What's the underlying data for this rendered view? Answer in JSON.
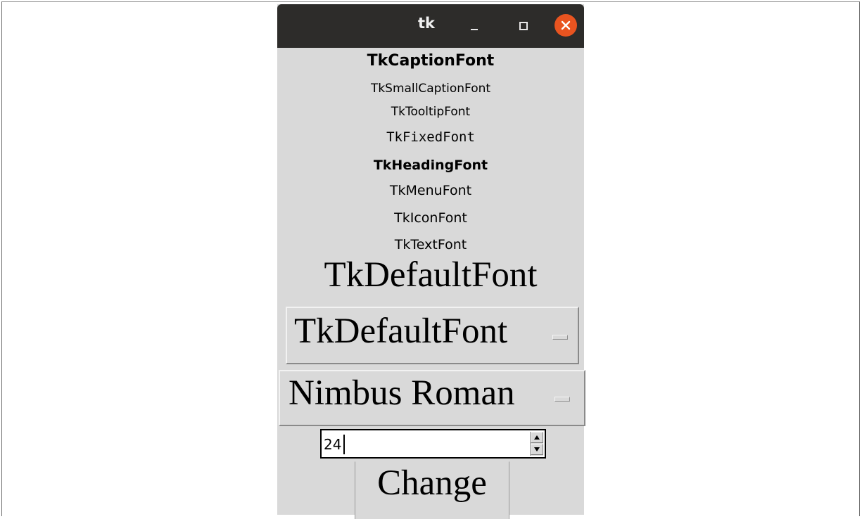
{
  "window": {
    "title": "tk",
    "controls": {
      "minimize_icon": "minimize-icon",
      "maximize_icon": "maximize-icon",
      "close_icon": "close-icon",
      "close_color": "#e95420"
    }
  },
  "fonts": {
    "caption": "TkCaptionFont",
    "small_caption": "TkSmallCaptionFont",
    "tooltip": "TkTooltipFont",
    "fixed": "TkFixedFont",
    "heading": "TkHeadingFont",
    "menu": "TkMenuFont",
    "icon": "TkIconFont",
    "text": "TkTextFont",
    "default": "TkDefaultFont"
  },
  "font_selector": {
    "selected": "TkDefaultFont"
  },
  "family_selector": {
    "selected": "Nimbus Roman"
  },
  "size_spinbox": {
    "value": "24"
  },
  "change_button": {
    "label": "Change"
  },
  "colors": {
    "window_bg": "#d9d9d9",
    "titlebar_bg": "#2d2c2a"
  }
}
